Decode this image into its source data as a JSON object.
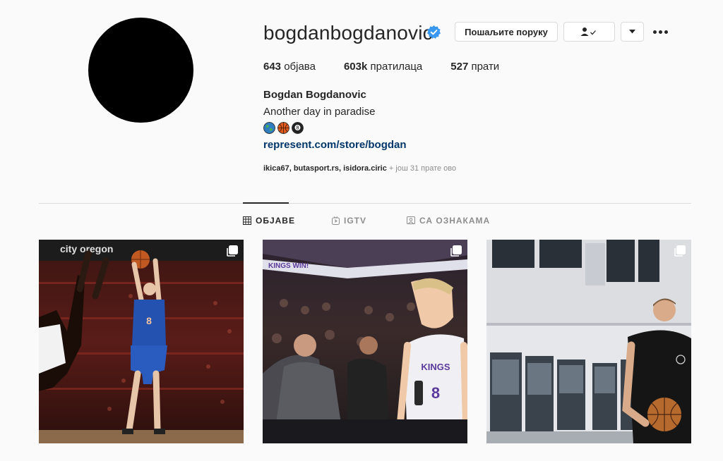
{
  "profile": {
    "username": "bogdanbogdanovic",
    "verified": true,
    "full_name": "Bogdan Bogdanovic",
    "bio": "Another day in paradise",
    "emojis": [
      "globe-emoji",
      "basketball-emoji",
      "8-ball-emoji"
    ],
    "link": "represent.com/store/bogdan"
  },
  "actions": {
    "message_label": "Пошаљите поруку",
    "follow_icon": "person-check-icon",
    "dropdown_icon": "caret-down-icon",
    "more_icon": "more-dots-icon"
  },
  "stats": {
    "posts_count": "643",
    "posts_label": " објава",
    "followers_count": "603k",
    "followers_label": " пратилаца",
    "following_count": "527",
    "following_label": " прати"
  },
  "followed_by": {
    "names": "ikica67, butasport.rs, isidora.ciric",
    "more_text": " + још 31 прате ово"
  },
  "tabs": [
    {
      "label": "ОБЈАВЕ",
      "active": true,
      "icon": "grid-icon"
    },
    {
      "label": "IGTV",
      "active": false,
      "icon": "igtv-icon"
    },
    {
      "label": "СА ОЗНАКАМА",
      "active": false,
      "icon": "tagged-icon"
    }
  ],
  "posts": [
    {
      "overlay_text": "city oregon",
      "jersey_number": "8",
      "multi": true
    },
    {
      "overlay_text": "KINGS WIN!",
      "jersey_text": "KINGS",
      "jersey_number": "8",
      "multi": true
    },
    {
      "multi": true
    }
  ],
  "colors": {
    "link": "#00376b",
    "verified": "#3897f0",
    "divider": "#dbdbdb",
    "muted": "#8e8e8e"
  }
}
